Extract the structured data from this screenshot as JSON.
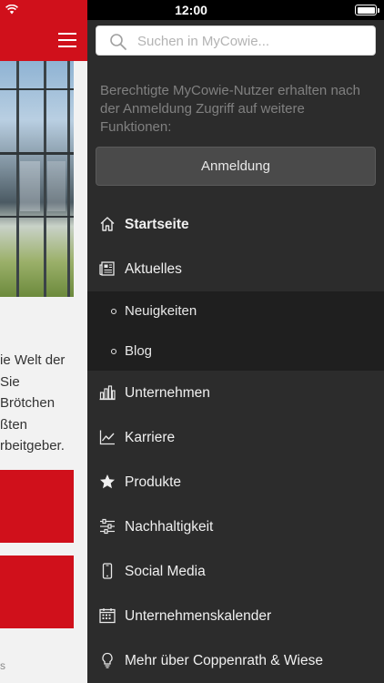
{
  "status_bar": {
    "time": "12:00"
  },
  "background_app": {
    "text_lines": [
      "ie Welt der",
      "Sie",
      "Brötchen",
      "ßten",
      "rbeitgeber."
    ],
    "footer_text": "s"
  },
  "search": {
    "placeholder": "Suchen in MyCowie..."
  },
  "notice": "Berechtigte MyCowie-Nutzer erhalten nach der Anmeldung Zugriff auf weitere Funktionen:",
  "login_button": "Anmeldung",
  "menu": {
    "items": [
      {
        "label": "Startseite",
        "icon": "home-icon",
        "active": true
      },
      {
        "label": "Aktuelles",
        "icon": "newspaper-icon"
      },
      {
        "label": "Unternehmen",
        "icon": "building-icon"
      },
      {
        "label": "Karriere",
        "icon": "chart-icon"
      },
      {
        "label": "Produkte",
        "icon": "star-icon"
      },
      {
        "label": "Nachhaltigkeit",
        "icon": "sliders-icon"
      },
      {
        "label": "Social Media",
        "icon": "phone-icon"
      },
      {
        "label": "Unternehmenskalender",
        "icon": "calendar-icon"
      },
      {
        "label": "Mehr über Coppenrath & Wiese",
        "icon": "lightbulb-icon"
      }
    ],
    "sub_items": [
      {
        "label": "Neuigkeiten"
      },
      {
        "label": "Blog"
      }
    ]
  },
  "colors": {
    "brand_red": "#d0101b",
    "drawer_bg": "#2c2c2c",
    "submenu_bg": "#1f1f1f"
  }
}
